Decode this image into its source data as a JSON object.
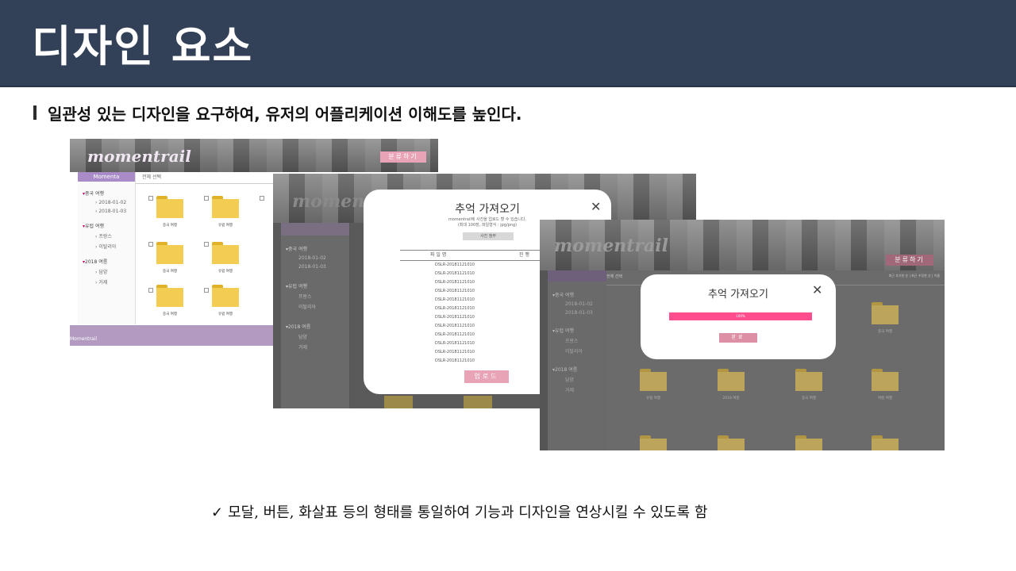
{
  "header": {
    "title": "디자인 요소"
  },
  "subtitle": "일관성 있는 디자인을 요구하여, 유저의 어플리케이션 이해도를 높인다.",
  "note": {
    "check": "✓",
    "text": "모달, 버튼, 화살표 등의 형태를 통일하여 기능과 디자인을 연상시킬 수 있도록 함"
  },
  "screen1": {
    "logo": "momentrail",
    "top_button": "분류하기",
    "sidebar_title": "Momenta",
    "select_all": "전체 선택",
    "groups": [
      {
        "name": "중국 여행",
        "items": [
          "2018-01-02",
          "2018-01-03"
        ]
      },
      {
        "name": "유럽 여행",
        "items": [
          "프랑스",
          "이탈리아"
        ]
      },
      {
        "name": "2018 여름",
        "items": [
          "담양",
          "거제"
        ]
      }
    ],
    "folders": [
      "중국 여행",
      "유럽 여행",
      "중국 여행",
      "유럽 여행",
      "중국 여행",
      "유럽 여행"
    ],
    "footer": "Momentrail"
  },
  "screen2": {
    "logo": "momentrail",
    "modal_title": "추억 가져오기",
    "modal_desc_1": "momentrail에 사진을 업로드 할 수 있습니다.",
    "modal_desc_2": "(최대 100장, 파일형식 : jpg/png)",
    "select_button": "사진 첨부",
    "col_filename": "파 일 명",
    "col_second": "진 행",
    "files": [
      "DSLR-20181121010",
      "DSLR-20181121010",
      "DSLR-20181121010",
      "DSLR-20181121010",
      "DSLR-20181121010",
      "DSLR-20181121010",
      "DSLR-20181121010",
      "DSLR-20181121010",
      "DSLR-20181121010",
      "DSLR-20181121010",
      "DSLR-20181121010",
      "DSLR-20181121010"
    ],
    "upload_button": "업로드",
    "close": "✕",
    "sidebar_groups": [
      {
        "name": "중국 여행",
        "items": [
          "2018-01-02",
          "2018-01-03"
        ]
      },
      {
        "name": "유럽 여행",
        "items": [
          "프랑스",
          "이탈리아"
        ]
      },
      {
        "name": "2018 여름",
        "items": [
          "담양",
          "거제"
        ]
      }
    ]
  },
  "screen3": {
    "logo": "momentrail",
    "top_button": "분류하기",
    "toolbar_select": "전체 선택",
    "toolbar_right": "최근 추가한 순 | 최근 수정한 순 | 이름",
    "modal_title": "추억 가져오기",
    "close": "✕",
    "progress": 100,
    "progress_label": "100%",
    "done_button": "완료",
    "sidebar_groups": [
      {
        "name": "중국 여행",
        "items": [
          "2018-01-02",
          "2018-01-03"
        ]
      },
      {
        "name": "유럽 여행",
        "items": [
          "프랑스",
          "이탈리아"
        ]
      },
      {
        "name": "2018 여름",
        "items": [
          "담양",
          "거제"
        ]
      }
    ],
    "folders": [
      "중국 여행",
      "유럽 여행",
      "2018 여름",
      "중국 여행",
      "여름 여행"
    ]
  }
}
